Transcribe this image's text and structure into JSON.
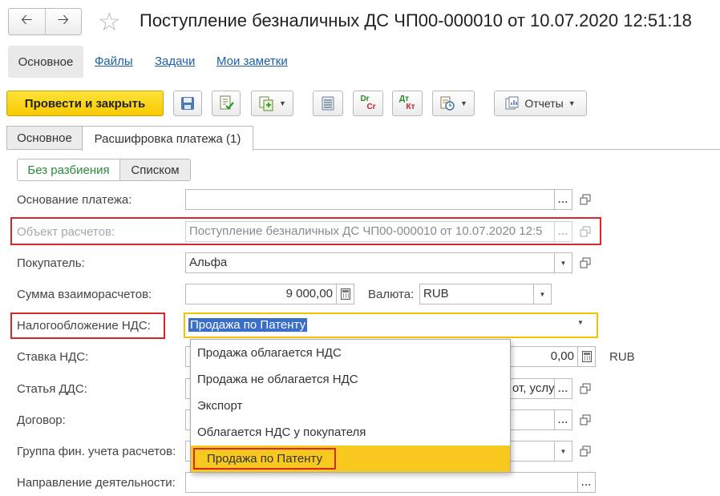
{
  "window": {
    "title": "Поступление безналичных ДС ЧП00-000010 от 10.07.2020 12:51:18"
  },
  "topnav": {
    "main": "Основное",
    "files": "Файлы",
    "tasks": "Задачи",
    "notes": "Мои заметки"
  },
  "toolbar": {
    "post_close": "Провести и закрыть",
    "dt_top": "Dr",
    "dt_bottom": "Cr",
    "dtkt_top": "Дт",
    "dtkt_bottom": "Кт",
    "reports": "Отчеты"
  },
  "tabs": {
    "main": "Основное",
    "decode": "Расшифровка платежа (1)"
  },
  "segment": {
    "no_split": "Без разбиения",
    "list": "Списком"
  },
  "form": {
    "basis_label": "Основание платежа:",
    "basis_value": "",
    "object_label": "Объект расчетов:",
    "object_value": "Поступление безналичных ДС ЧП00-000010 от 10.07.2020 12:5",
    "buyer_label": "Покупатель:",
    "buyer_value": "Альфа",
    "sum_label": "Сумма взаиморасчетов:",
    "sum_value": "9 000,00",
    "currency_label": "Валюта:",
    "currency_value": "RUB",
    "vat_tax_label": "Налогообложение НДС:",
    "vat_tax_value": "Продажа по Патенту",
    "vat_rate_label": "Ставка НДС:",
    "vat_amount_value": "0,00",
    "vat_currency": "RUB",
    "dds_label": "Статья ДДС:",
    "dds_value_tail": "от, услу",
    "contract_label": "Договор:",
    "group_label": "Группа фин. учета расчетов:",
    "direction_label": "Направление деятельности:"
  },
  "dropdown": {
    "options": [
      "Продажа облагается НДС",
      "Продажа не облагается НДС",
      "Экспорт",
      "Облагается НДС у покупателя",
      "Продажа по Патенту"
    ],
    "selected_index": 4
  }
}
